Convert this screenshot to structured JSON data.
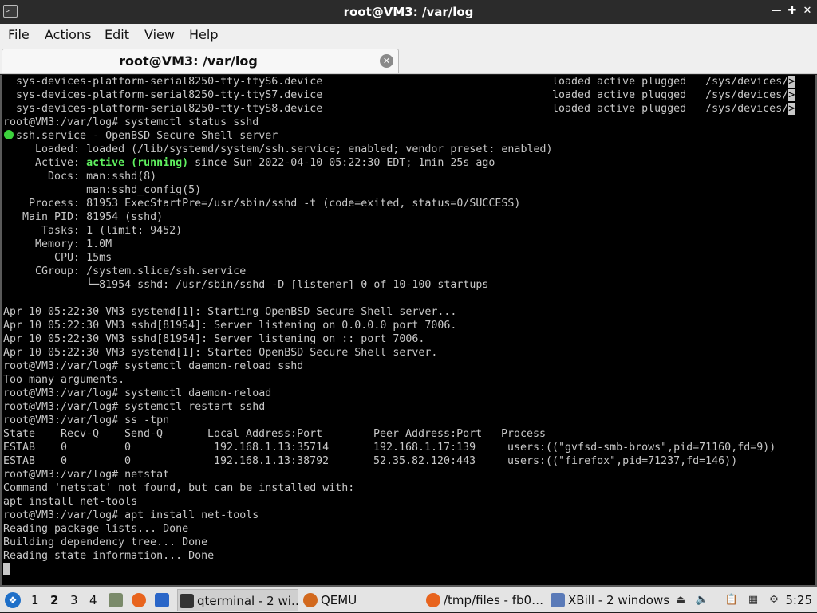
{
  "window": {
    "title": "root@VM3: /var/log",
    "btn_minimize": "—",
    "btn_maximize": "✚",
    "btn_close": "✕"
  },
  "menu": [
    "File",
    "Actions",
    "Edit",
    "View",
    "Help"
  ],
  "tab": {
    "label": "root@VM3: /var/log",
    "close": "✕"
  },
  "terminal": {
    "units": [
      {
        "name": "sys-devices-platform-serial8250-tty-ttyS6.device",
        "status": "loaded active plugged   /sys/devices/"
      },
      {
        "name": "sys-devices-platform-serial8250-tty-ttyS7.device",
        "status": "loaded active plugged   /sys/devices/"
      },
      {
        "name": "sys-devices-platform-serial8250-tty-ttyS8.device",
        "status": "loaded active plugged   /sys/devices/"
      }
    ],
    "trunc_marker": ">",
    "cmd_status": "root@VM3:/var/log# systemctl status sshd",
    "svc_line": "ssh.service - OpenBSD Secure Shell server",
    "loaded": "     Loaded: loaded (/lib/systemd/system/ssh.service; enabled; vendor preset: enabled)",
    "active_prefix": "     Active: ",
    "active_state": "active (running)",
    "active_suffix": " since Sun 2022-04-10 05:22:30 EDT; 1min 25s ago",
    "docs1": "       Docs: man:sshd(8)",
    "docs2": "             man:sshd_config(5)",
    "process": "    Process: 81953 ExecStartPre=/usr/sbin/sshd -t (code=exited, status=0/SUCCESS)",
    "mainpid": "   Main PID: 81954 (sshd)",
    "tasks": "      Tasks: 1 (limit: 9452)",
    "memory": "     Memory: 1.0M",
    "cpu": "        CPU: 15ms",
    "cgroup": "     CGroup: /system.slice/ssh.service",
    "cgroup_child": "             └─81954 sshd: /usr/sbin/sshd -D [listener] 0 of 10-100 startups",
    "log1": "Apr 10 05:22:30 VM3 systemd[1]: Starting OpenBSD Secure Shell server...",
    "log2": "Apr 10 05:22:30 VM3 sshd[81954]: Server listening on 0.0.0.0 port 7006.",
    "log3": "Apr 10 05:22:30 VM3 sshd[81954]: Server listening on :: port 7006.",
    "log4": "Apr 10 05:22:30 VM3 systemd[1]: Started OpenBSD Secure Shell server.",
    "cmd_reload_sshd": "root@VM3:/var/log# systemctl daemon-reload sshd",
    "too_many": "Too many arguments.",
    "cmd_reload": "root@VM3:/var/log# systemctl daemon-reload",
    "cmd_restart": "root@VM3:/var/log# systemctl restart sshd",
    "cmd_ss": "root@VM3:/var/log# ss -tpn",
    "ss_headers": [
      "State",
      "Recv-Q",
      "Send-Q",
      "Local Address:Port",
      "Peer Address:Port",
      "Process"
    ],
    "ss_rows": [
      [
        "ESTAB",
        "0",
        "0",
        "192.168.1.13:35714",
        "192.168.1.17:139",
        "users:((\"gvfsd-smb-brows\",pid=71160,fd=9))"
      ],
      [
        "ESTAB",
        "0",
        "0",
        "192.168.1.13:38792",
        "52.35.82.120:443",
        "users:((\"firefox\",pid=71237,fd=146))"
      ]
    ],
    "cmd_netstat": "root@VM3:/var/log# netstat",
    "netstat_err": "Command 'netstat' not found, but can be installed with:",
    "netstat_hint": "apt install net-tools",
    "cmd_apt": "root@VM3:/var/log# apt install net-tools",
    "apt1": "Reading package lists... Done",
    "apt2": "Building dependency tree... Done",
    "apt3": "Reading state information... Done"
  },
  "taskbar": {
    "workspaces": [
      "1",
      "2",
      "3",
      "4"
    ],
    "current_workspace": "2",
    "tasks": [
      {
        "label": "qterminal - 2 wi…",
        "icon": "terminal-icon",
        "active": true
      },
      {
        "label": "QEMU",
        "icon": "qemu-icon",
        "active": false
      },
      {
        "label": "/tmp/files - fb0…",
        "icon": "firefox-icon",
        "active": false
      },
      {
        "label": "XBill - 2 windows",
        "icon": "xbill-icon",
        "active": false
      }
    ],
    "clock": "5:25"
  },
  "colors": {
    "terminal_bg": "#000000",
    "terminal_fg": "#c8c8c8",
    "active_green": "#5ff05f",
    "status_dot": "#3cd23c"
  }
}
